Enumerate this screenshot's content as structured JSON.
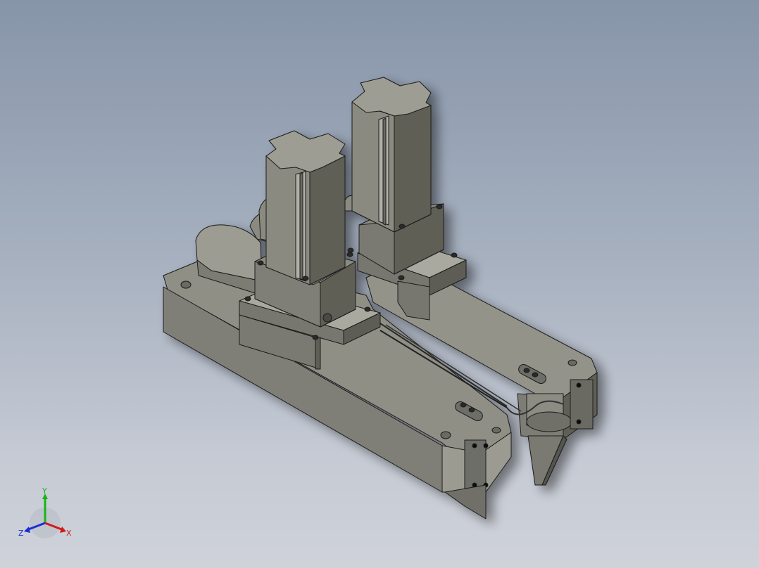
{
  "viewport": {
    "background_top": "#8795a9",
    "background_bottom": "#cfd2d9"
  },
  "model": {
    "body_color": "#8f8f86",
    "face_light": "#b5b5ab",
    "face_mid": "#8a8a81",
    "face_dark": "#5e5e57",
    "edge_color": "#1a1a1a"
  },
  "triad": {
    "x_label": "X",
    "y_label": "Y",
    "z_label": "Z",
    "x_color": "#d11a1a",
    "y_color": "#18b418",
    "z_color": "#1a2fd1"
  }
}
